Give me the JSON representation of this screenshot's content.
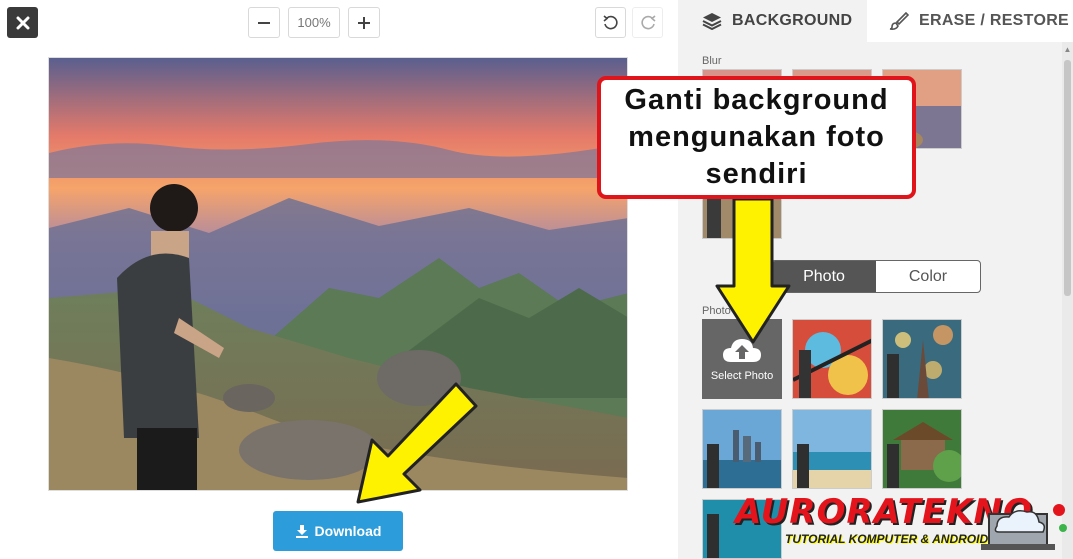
{
  "toolbar": {
    "zoom_value": "100%"
  },
  "download": {
    "label": "Download"
  },
  "panel": {
    "tabs": [
      {
        "label": "BACKGROUND",
        "active": true
      },
      {
        "label": "ERASE / RESTORE",
        "active": false
      }
    ],
    "blur_label": "Blur",
    "photo_label": "Photo",
    "segment": {
      "photo": "Photo",
      "color": "Color",
      "selected": "Photo"
    },
    "select_photo_label": "Select Photo"
  },
  "annotation": {
    "line1": "Ganti background",
    "line2": "mengunakan foto",
    "line3": "sendiri"
  },
  "watermark": {
    "title": "AURORATEKNO",
    "subtitle": "TUTORIAL KOMPUTER & ANDROID"
  },
  "colors": {
    "accent_blue": "#2d9cdb",
    "callout_border": "#e0151b",
    "arrow_yellow": "#fff200"
  }
}
